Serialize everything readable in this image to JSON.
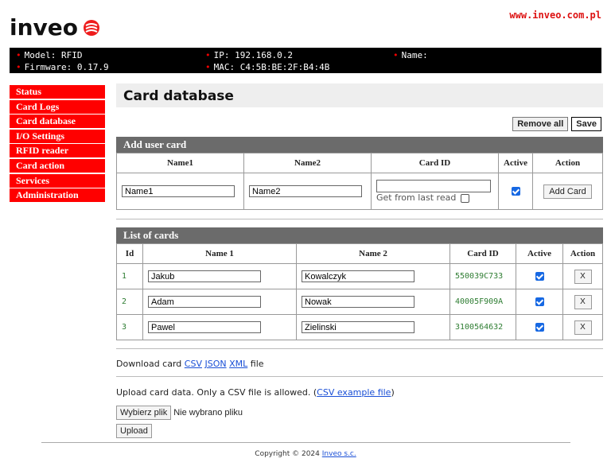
{
  "brand": {
    "logo_text": "inveo",
    "url": "www.inveo.com.pl",
    "accent": "#ff0000"
  },
  "info": {
    "model": "Model: RFID",
    "firmware": "Firmware: 0.17.9",
    "ip": "IP: 192.168.0.2",
    "mac": "MAC: C4:5B:BE:2F:B4:4B",
    "name": "Name:"
  },
  "sidebar": {
    "items": [
      {
        "label": "Status"
      },
      {
        "label": "Card Logs"
      },
      {
        "label": "Card database"
      },
      {
        "label": "I/O Settings"
      },
      {
        "label": "RFID reader"
      },
      {
        "label": "Card action"
      },
      {
        "label": "Services"
      },
      {
        "label": "Administration"
      }
    ]
  },
  "page": {
    "title": "Card database",
    "remove_all": "Remove all",
    "save": "Save"
  },
  "add_card": {
    "heading": "Add user card",
    "headers": [
      "Name1",
      "Name2",
      "Card ID",
      "Active",
      "Action"
    ],
    "name1_value": "Name1",
    "name2_value": "Name2",
    "card_id_value": "",
    "get_from_last_read": "Get from last read",
    "active": true,
    "add_label": "Add Card"
  },
  "cards": {
    "heading": "List of cards",
    "headers": [
      "Id",
      "Name 1",
      "Name 2",
      "Card ID",
      "Active",
      "Action"
    ],
    "rows": [
      {
        "id": "1",
        "name1": "Jakub",
        "name2": "Kowalczyk",
        "card_id": "550039C733",
        "active": true,
        "action": "X"
      },
      {
        "id": "2",
        "name1": "Adam",
        "name2": "Nowak",
        "card_id": "40005F909A",
        "active": true,
        "action": "X"
      },
      {
        "id": "3",
        "name1": "Pawel",
        "name2": "Zielinski",
        "card_id": "3100564632",
        "active": true,
        "action": "X"
      }
    ]
  },
  "download": {
    "prefix": "Download card",
    "csv": "CSV",
    "json": "JSON",
    "xml": "XML",
    "suffix": "file"
  },
  "upload": {
    "text": "Upload card data. Only a CSV file is allowed. (",
    "example_link": "CSV example file",
    "text_end": ")",
    "choose_button": "Wybierz plik",
    "no_file": "Nie wybrano pliku",
    "upload_button": "Upload"
  },
  "footer": {
    "copyright": "Copyright © 2024",
    "company": "Inveo s.c."
  }
}
